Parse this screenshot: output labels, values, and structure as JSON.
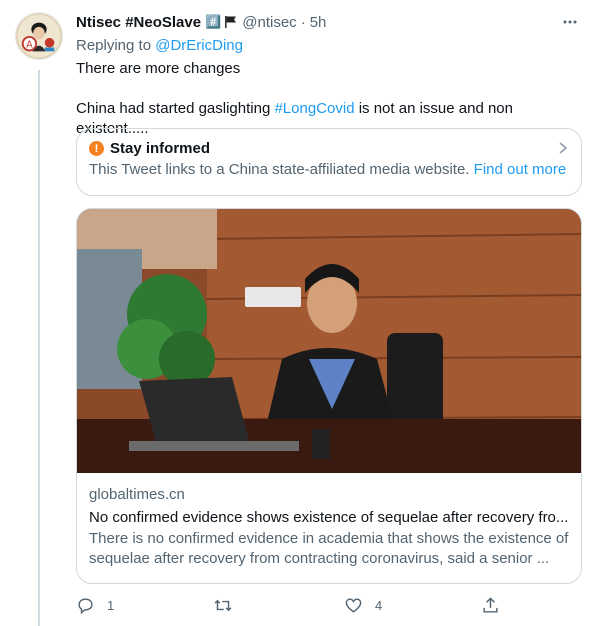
{
  "tweet": {
    "display_name": "Ntisec #NeoSlave",
    "name_emoji": "#️⃣",
    "handle": "@ntisec",
    "separator": "·",
    "time": "5h",
    "replying_prefix": "Replying to",
    "replying_to": "@DrEricDing",
    "line1": "There are more changes",
    "line2_before": "China had started gaslighting",
    "line2_hashtag": "#LongCovid",
    "line2_after": "is not an issue and non existent.....",
    "icons": [
      "avatar",
      "flag-icon",
      "more-icon"
    ]
  },
  "notice": {
    "title": "Stay informed",
    "body": "This Tweet links to a China state-affiliated media website.",
    "link": "Find out more",
    "icon": "warning-icon",
    "accent": "#f58220"
  },
  "card": {
    "domain": "globaltimes.cn",
    "title": "No confirmed evidence shows existence of sequelae after recovery fro...",
    "description": "There is no confirmed evidence in academia that shows the existence of sequelae after recovery from contracting coronavirus, said a senior ..."
  },
  "actions": {
    "reply_count": "1",
    "retweet_count": "",
    "like_count": "4",
    "icons": [
      "reply-icon",
      "retweet-icon",
      "like-icon",
      "share-icon"
    ]
  },
  "colors": {
    "link": "#1d9bf0",
    "muted": "#536471",
    "border": "#cfd9de",
    "text": "#0f1419"
  }
}
